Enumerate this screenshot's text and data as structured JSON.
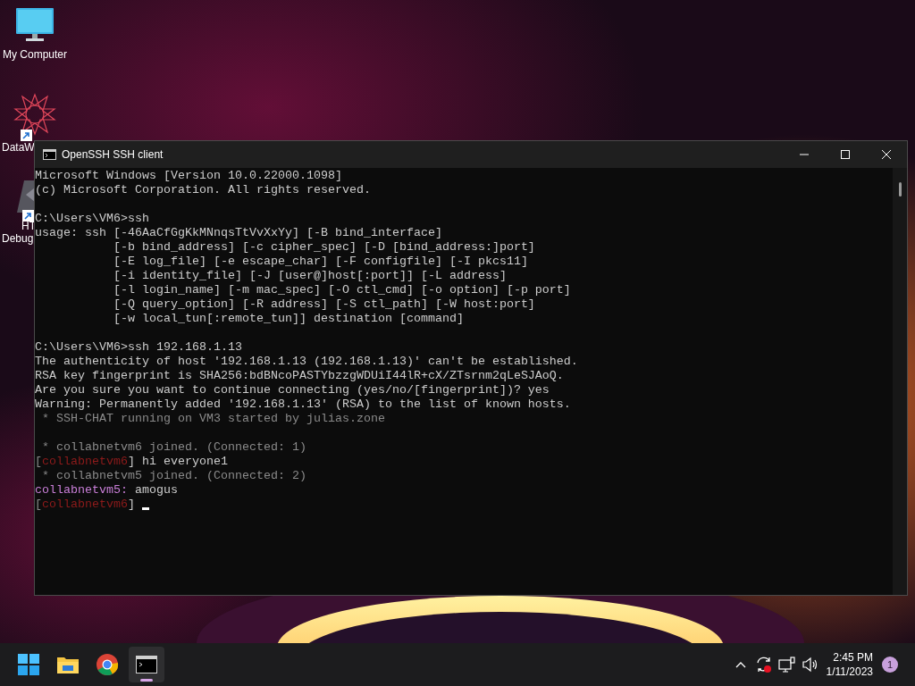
{
  "desktop_icons": [
    {
      "kind": "monitor",
      "label": "My Computer",
      "shortcut": false
    },
    {
      "kind": "star",
      "label": "DataW",
      "shortcut": true
    },
    {
      "kind": "shape",
      "label": "HT",
      "label_2": "Debug",
      "shortcut": true
    }
  ],
  "window": {
    "title": "OpenSSH SSH client",
    "blocks": [
      [
        [
          {
            "text": "Microsoft Windows [Version 10.0.22000.1098]",
            "color": "#cccccc"
          }
        ],
        [
          {
            "text": "(c) Microsoft Corporation. All rights reserved.",
            "color": "#cccccc"
          }
        ]
      ],
      [
        [
          {
            "text": "C:\\Users\\VM6>ssh",
            "color": "#cccccc"
          }
        ],
        [
          {
            "text": "usage: ssh [-46AaCfGgKkMNnqsTtVvXxYy] [-B bind_interface]",
            "color": "#cccccc"
          }
        ],
        [
          {
            "text": "           [-b bind_address] [-c cipher_spec] [-D [bind_address:]port]",
            "color": "#cccccc"
          }
        ],
        [
          {
            "text": "           [-E log_file] [-e escape_char] [-F configfile] [-I pkcs11]",
            "color": "#cccccc"
          }
        ],
        [
          {
            "text": "           [-i identity_file] [-J [user@]host[:port]] [-L address]",
            "color": "#cccccc"
          }
        ],
        [
          {
            "text": "           [-l login_name] [-m mac_spec] [-O ctl_cmd] [-o option] [-p port]",
            "color": "#cccccc"
          }
        ],
        [
          {
            "text": "           [-Q query_option] [-R address] [-S ctl_path] [-W host:port]",
            "color": "#cccccc"
          }
        ],
        [
          {
            "text": "           [-w local_tun[:remote_tun]] destination [command]",
            "color": "#cccccc"
          }
        ]
      ],
      [
        [
          {
            "text": "C:\\Users\\VM6>ssh 192.168.1.13",
            "color": "#cccccc"
          }
        ],
        [
          {
            "text": "The authenticity of host '192.168.1.13 (192.168.1.13)' can't be established.",
            "color": "#cccccc"
          }
        ],
        [
          {
            "text": "RSA key fingerprint is SHA256:bdBNcoPASTYbzzgWDUiI44lR+cX/ZTsrnm2qLeSJAoQ.",
            "color": "#cccccc"
          }
        ],
        [
          {
            "text": "Are you sure you want to continue connecting (yes/no/[fingerprint])? yes",
            "color": "#cccccc"
          }
        ],
        [
          {
            "text": "Warning: Permanently added '192.168.1.13' (RSA) to the list of known hosts.",
            "color": "#cccccc"
          }
        ],
        [
          {
            "text": " * SSH-CHAT running on VM3 started by julias.zone",
            "color": "#8a8a8a"
          }
        ]
      ],
      [
        [
          {
            "text": " * collabnetvm6 joined. (Connected: 1)",
            "color": "#8a8a8a"
          }
        ],
        [
          {
            "text": "[",
            "color": "#8a8a8a"
          },
          {
            "text": "collabnetvm6",
            "color": "#8e1b1b"
          },
          {
            "text": "] hi everyone1",
            "color": "#cccccc"
          }
        ],
        [
          {
            "text": " * collabnetvm5 joined. (Connected: 2)",
            "color": "#8a8a8a"
          }
        ],
        [
          {
            "text": "collabnetvm5:",
            "color": "#c97fd8"
          },
          {
            "text": " amogus",
            "color": "#cccccc"
          }
        ],
        [
          {
            "text": "[",
            "color": "#8a8a8a"
          },
          {
            "text": "collabnetvm6",
            "color": "#8e1b1b"
          },
          {
            "text": "] ",
            "color": "#cccccc"
          }
        ]
      ]
    ],
    "cursor": true
  },
  "taskbar": {
    "apps": [
      {
        "kind": "start",
        "selected": false
      },
      {
        "kind": "folder",
        "selected": false
      },
      {
        "kind": "browser",
        "selected": false
      },
      {
        "kind": "terminal",
        "selected": true
      }
    ],
    "tray": [
      {
        "kind": "chevron"
      },
      {
        "kind": "sync"
      },
      {
        "kind": "network"
      },
      {
        "kind": "speaker"
      }
    ],
    "time": "2:45 PM",
    "date": "1/11/2023",
    "notifications": "1"
  }
}
